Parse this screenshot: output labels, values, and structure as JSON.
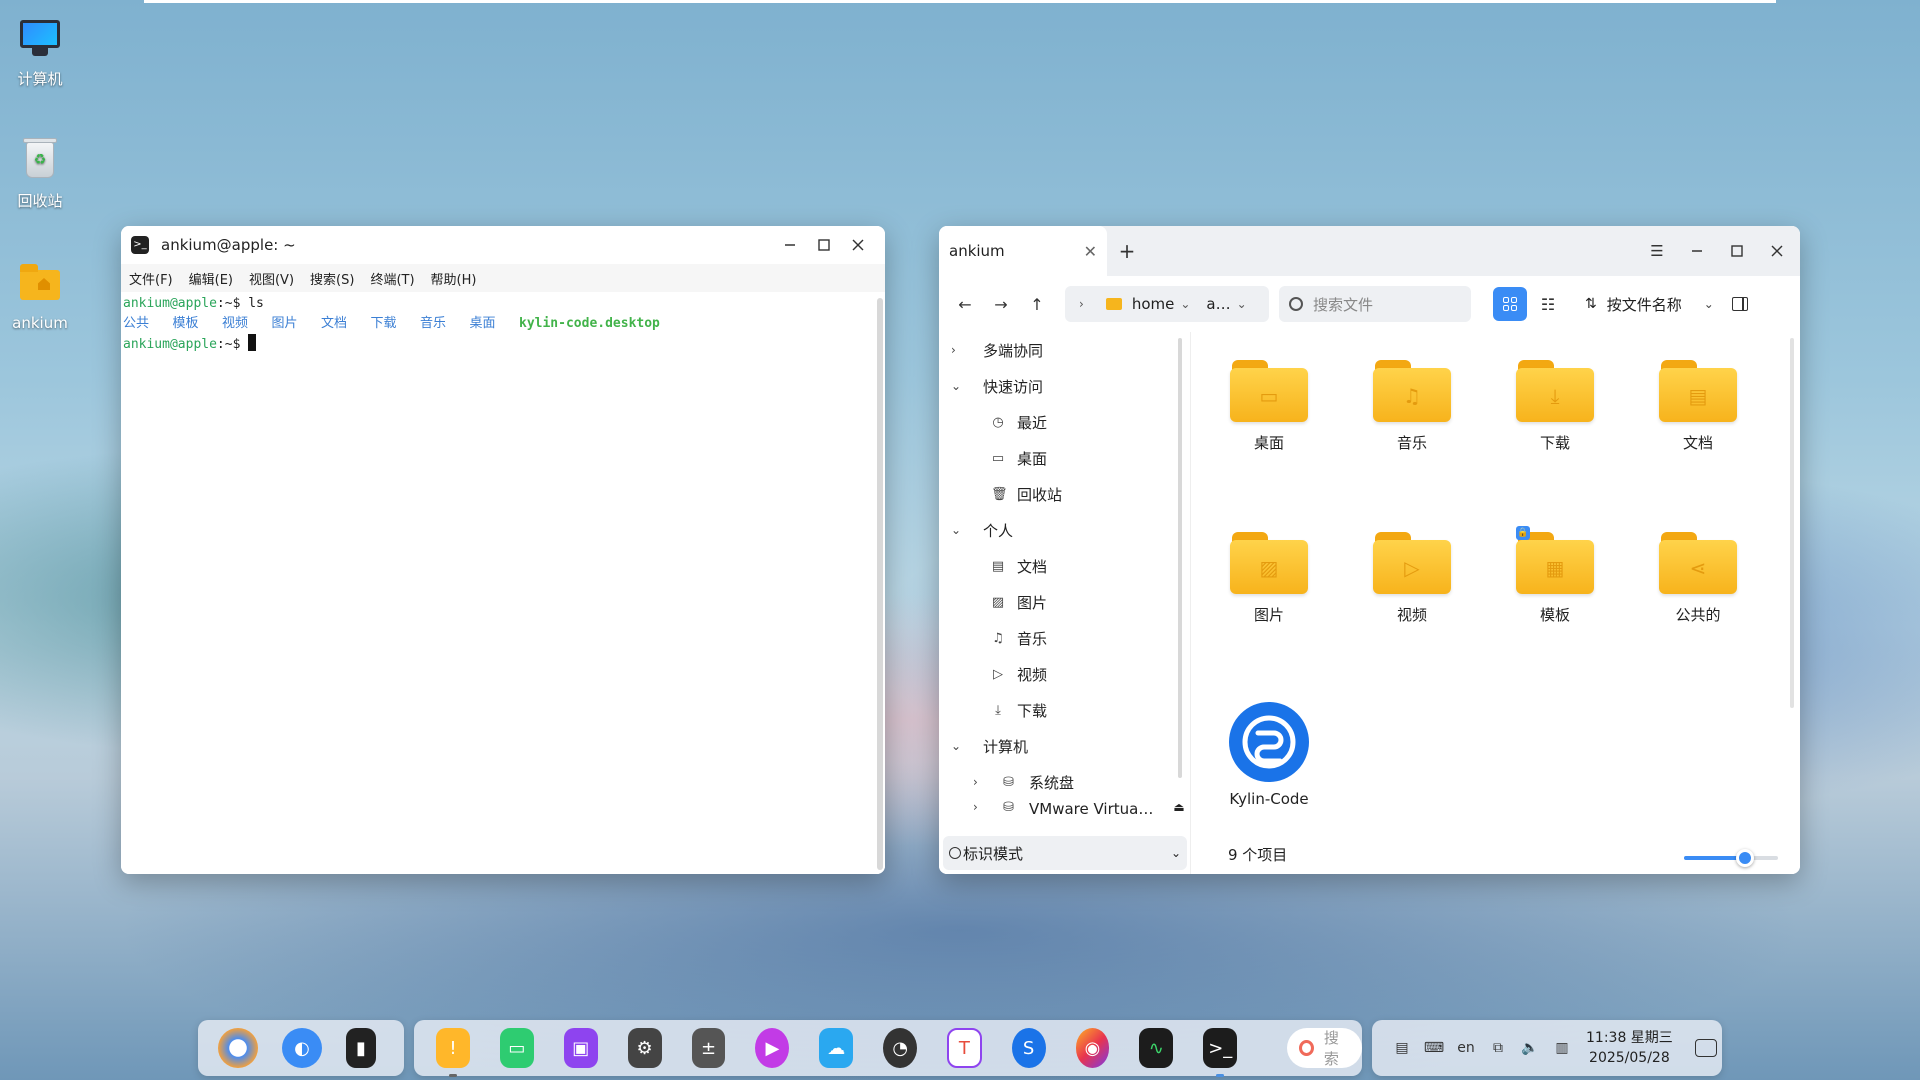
{
  "desktop": {
    "icons": [
      {
        "label": "计算机",
        "icon": "computer-icon"
      },
      {
        "label": "回收站",
        "icon": "trash-icon"
      },
      {
        "label": "ankium",
        "icon": "home-folder-icon"
      }
    ]
  },
  "terminal": {
    "title": "ankium@apple: ~",
    "menu": [
      "文件(F)",
      "编辑(E)",
      "视图(V)",
      "搜索(S)",
      "终端(T)",
      "帮助(H)"
    ],
    "prompt_user": "ankium@apple",
    "prompt_suffix": ":~$ ",
    "command": "ls",
    "ls_dirs": [
      "公共",
      "模板",
      "视频",
      "图片",
      "文档",
      "下载",
      "音乐",
      "桌面"
    ],
    "ls_file": "kylin-code.desktop"
  },
  "filemanager": {
    "tab_label": "ankium",
    "new_tab": "+",
    "breadcrumb": {
      "path1": "home",
      "path2": "a…"
    },
    "search_placeholder": "搜索文件",
    "sort_label": "按文件名称",
    "sidebar": {
      "groups": [
        {
          "label": "多端协同",
          "expanded": false
        },
        {
          "label": "快速访问",
          "expanded": true
        },
        {
          "label": "个人",
          "expanded": true
        },
        {
          "label": "计算机",
          "expanded": true
        }
      ],
      "quick": [
        {
          "label": "最近",
          "icon": "clock-icon"
        },
        {
          "label": "桌面",
          "icon": "desktop-icon"
        },
        {
          "label": "回收站",
          "icon": "trash-icon"
        }
      ],
      "personal": [
        {
          "label": "文档",
          "icon": "document-icon"
        },
        {
          "label": "图片",
          "icon": "picture-icon"
        },
        {
          "label": "音乐",
          "icon": "music-icon"
        },
        {
          "label": "视频",
          "icon": "video-icon"
        },
        {
          "label": "下载",
          "icon": "download-icon"
        }
      ],
      "computer": [
        {
          "label": "系统盘",
          "icon": "disk-icon"
        },
        {
          "label": "VMware Virtua…",
          "icon": "drive-icon"
        }
      ],
      "mark_mode": "标识模式"
    },
    "items": [
      {
        "label": "桌面",
        "emblem": "desktop-emblem"
      },
      {
        "label": "音乐",
        "emblem": "music-emblem"
      },
      {
        "label": "下载",
        "emblem": "download-emblem"
      },
      {
        "label": "文档",
        "emblem": "document-emblem"
      },
      {
        "label": "图片",
        "emblem": "picture-emblem"
      },
      {
        "label": "视频",
        "emblem": "video-emblem"
      },
      {
        "label": "模板",
        "emblem": "template-emblem"
      },
      {
        "label": "公共的",
        "emblem": "share-emblem"
      },
      {
        "label": "Kylin-Code",
        "emblem": "kylin-code-app-icon"
      }
    ],
    "status": "9 个项目",
    "zoom_level": 0.65
  },
  "taskbar": {
    "search_placeholder": "搜索",
    "tray_lang": "en",
    "time": "11:38 星期三",
    "date": "2025/05/28",
    "colors": {
      "accent": "#3a8cf5"
    }
  }
}
